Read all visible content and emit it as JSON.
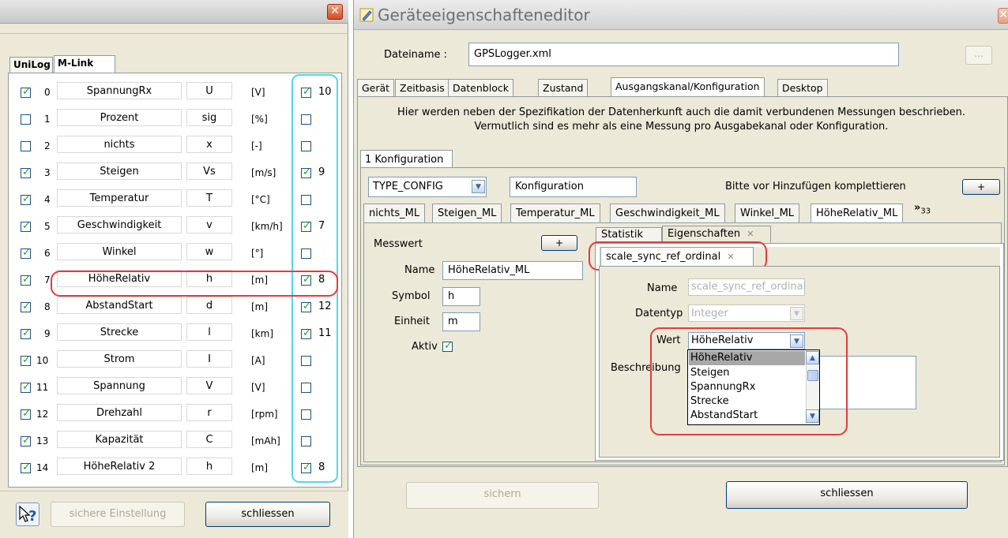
{
  "left_window": {
    "tabs": [
      "UniLog",
      "M-Link"
    ],
    "rows": [
      {
        "checked": true,
        "index": "0",
        "name": "SpannungRx",
        "symbol": "U",
        "unit": "[V]",
        "r_checked": true,
        "r_value": "10"
      },
      {
        "checked": false,
        "index": "1",
        "name": "Prozent",
        "symbol": "sig",
        "unit": "[%]",
        "r_checked": false,
        "r_value": ""
      },
      {
        "checked": false,
        "index": "2",
        "name": "nichts",
        "symbol": "x",
        "unit": "[-]",
        "r_checked": false,
        "r_value": ""
      },
      {
        "checked": true,
        "index": "3",
        "name": "Steigen",
        "symbol": "Vs",
        "unit": "[m/s]",
        "r_checked": true,
        "r_value": "9"
      },
      {
        "checked": true,
        "index": "4",
        "name": "Temperatur",
        "symbol": "T",
        "unit": "[°C]",
        "r_checked": false,
        "r_value": ""
      },
      {
        "checked": true,
        "index": "5",
        "name": "Geschwindigkeit",
        "symbol": "v",
        "unit": "[km/h]",
        "r_checked": true,
        "r_value": "7"
      },
      {
        "checked": true,
        "index": "6",
        "name": "Winkel",
        "symbol": "w",
        "unit": "[°]",
        "r_checked": false,
        "r_value": ""
      },
      {
        "checked": true,
        "index": "7",
        "name": "HöheRelativ",
        "symbol": "h",
        "unit": "[m]",
        "r_checked": true,
        "r_value": "8"
      },
      {
        "checked": true,
        "index": "8",
        "name": "AbstandStart",
        "symbol": "d",
        "unit": "[m]",
        "r_checked": true,
        "r_value": "12"
      },
      {
        "checked": true,
        "index": "9",
        "name": "Strecke",
        "symbol": "l",
        "unit": "[km]",
        "r_checked": true,
        "r_value": "11"
      },
      {
        "checked": true,
        "index": "10",
        "name": "Strom",
        "symbol": "I",
        "unit": "[A]",
        "r_checked": false,
        "r_value": ""
      },
      {
        "checked": true,
        "index": "11",
        "name": "Spannung",
        "symbol": "V",
        "unit": "[V]",
        "r_checked": false,
        "r_value": ""
      },
      {
        "checked": true,
        "index": "12",
        "name": "Drehzahl",
        "symbol": "r",
        "unit": "[rpm]",
        "r_checked": false,
        "r_value": ""
      },
      {
        "checked": true,
        "index": "13",
        "name": "Kapazität",
        "symbol": "C",
        "unit": "[mAh]",
        "r_checked": false,
        "r_value": ""
      },
      {
        "checked": true,
        "index": "14",
        "name": "HöheRelativ 2",
        "symbol": "h",
        "unit": "[m]",
        "r_checked": true,
        "r_value": "8"
      }
    ],
    "buttons": {
      "save_setting": "sichere Einstellung",
      "close": "schliessen"
    },
    "icons": {
      "close": "close-icon",
      "help": "help-icon"
    }
  },
  "right_window": {
    "title": "Geräteeigenschafteneditor",
    "filename_label": "Dateiname :",
    "filename_value": "GPSLogger.xml",
    "browse_label": "...",
    "tabs": [
      "Gerät",
      "Zeitbasis",
      "Datenblock",
      "Zustand",
      "Ausgangskanal/Konfiguration",
      "Desktop"
    ],
    "info_lines": [
      "Hier werden neben der Spezifikation der Datenherkunft auch die damit verbundenen Messungen beschrieben.",
      "Vermutlich sind es mehr als eine Messung pro Ausgabekanal oder Konfiguration."
    ],
    "config_tab": "1 Konfiguration",
    "config_type": "TYPE_CONFIG",
    "config_name": "Konfiguration",
    "hint": "Bitte vor Hinzufügen komplettieren",
    "add_label": "+",
    "measure_tabs": [
      "nichts_ML",
      "Steigen_ML",
      "Temperatur_ML",
      "Geschwindigkeit_ML",
      "Winkel_ML",
      "HöheRelativ_ML"
    ],
    "more_label": "»",
    "more_count": "33",
    "messwert": {
      "heading": "Messwert",
      "name_label": "Name",
      "name_value": "HöheRelativ_ML",
      "symbol_label": "Symbol",
      "symbol_value": "h",
      "unit_label": "Einheit",
      "unit_value": "m",
      "active_label": "Aktiv",
      "active_checked": true
    },
    "inner_tabs": [
      "Statistik",
      "Eigenschaften"
    ],
    "property_tab": "scale_sync_ref_ordinal",
    "property": {
      "name_label": "Name",
      "name_value": "scale_sync_ref_ordinal",
      "type_label": "Datentyp",
      "type_value": "Integer",
      "value_label": "Wert",
      "value_selected": "HöheRelativ",
      "description_label": "Beschreibung",
      "options": [
        "HöheRelativ",
        "Steigen",
        "SpannungRx",
        "Strecke",
        "AbstandStart"
      ]
    },
    "buttons": {
      "save": "sichern",
      "close": "schliessen"
    }
  },
  "colors": {
    "highlight_red": "#e23c3c",
    "highlight_cyan": "#57d4e8",
    "check_green": "#21a121",
    "xp_blue_border": "#003c74"
  }
}
